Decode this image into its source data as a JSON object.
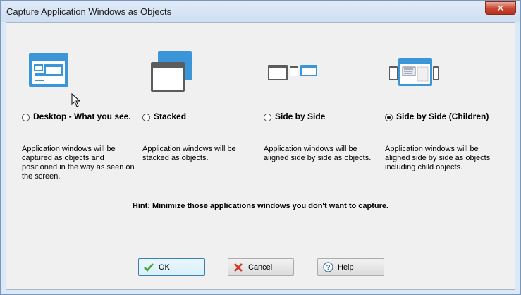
{
  "window": {
    "title": "Capture Application Windows as Objects"
  },
  "options": [
    {
      "label": "Desktop - What you see.",
      "description": "Application windows will be captured as objects and positioned in the way as seen on the screen.",
      "checked": false
    },
    {
      "label": "Stacked",
      "description": "Application windows will be stacked as objects.",
      "checked": false
    },
    {
      "label": "Side by Side",
      "description": "Application windows will be aligned side by side as objects.",
      "checked": false
    },
    {
      "label": "Side by Side (Children)",
      "description": "Application windows will be aligned side by side as objects including child objects.",
      "checked": true
    }
  ],
  "hint": "Hint: Minimize those applications windows you don't want to capture.",
  "buttons": {
    "ok": "OK",
    "cancel": "Cancel",
    "help": "Help"
  },
  "colors": {
    "accent_blue": "#3a96d8",
    "dark_gray": "#5c5c5c",
    "close_red": "#c7452f"
  }
}
